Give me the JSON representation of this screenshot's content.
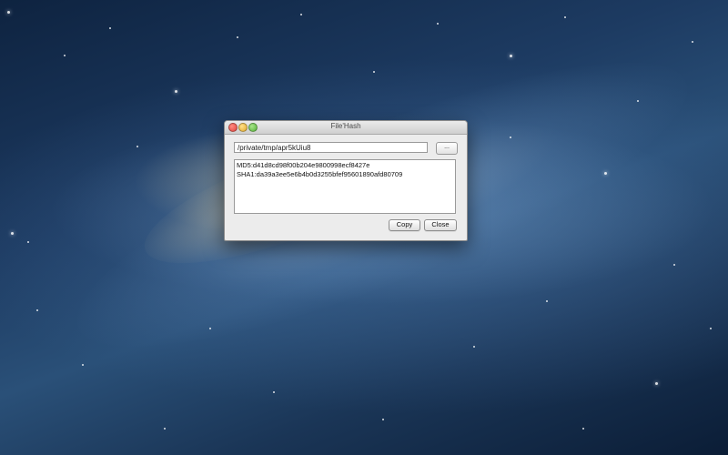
{
  "window": {
    "title": "File'Hash"
  },
  "file_path": {
    "value": "/private/tmp/apr5kUiu8"
  },
  "browse_button": {
    "label": "..."
  },
  "hash_results": [
    "MD5:d41d8cd98f00b204e9800998ecf8427e",
    "SHA1:da39a3ee5e6b4b0d3255bfef95601890afd80709"
  ],
  "buttons": {
    "copy_label": "Copy",
    "close_label": "Close"
  }
}
